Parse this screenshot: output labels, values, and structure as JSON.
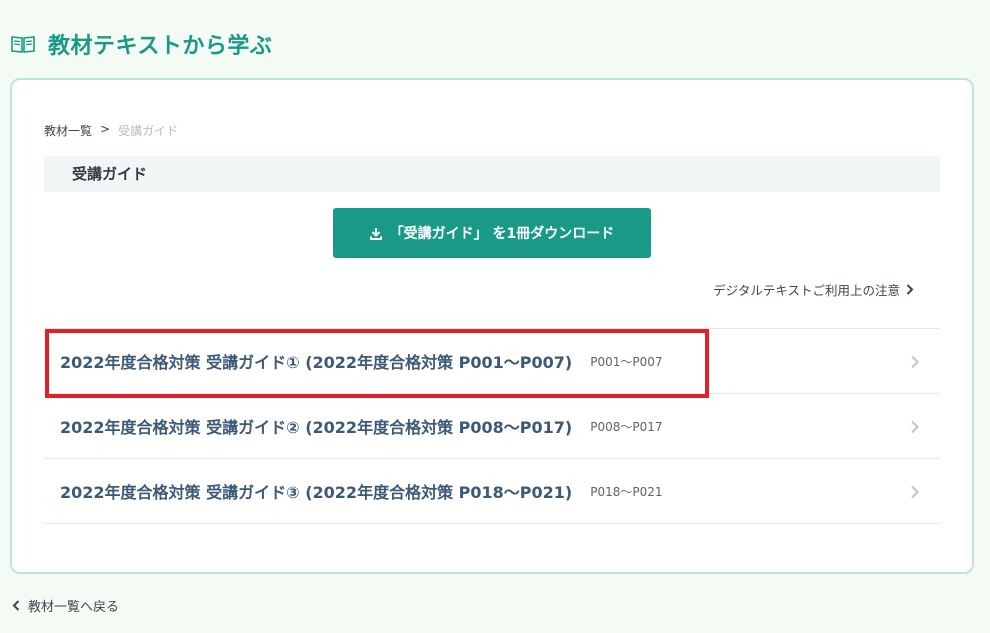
{
  "header": {
    "title": "教材テキストから学ぶ",
    "icon": "book-icon"
  },
  "breadcrumb": {
    "items": [
      "教材一覧",
      ">",
      "受講ガイド"
    ]
  },
  "section": {
    "title": "受講ガイド"
  },
  "download_button": {
    "label": "「受講ガイド」 を1冊ダウンロード",
    "icon": "download-icon"
  },
  "notice_link": {
    "label": "デジタルテキストご利用上の注意"
  },
  "items": [
    {
      "title": "2022年度合格対策 受講ガイド① (2022年度合格対策 P001〜P007)",
      "pages": "P001〜P007"
    },
    {
      "title": "2022年度合格対策 受講ガイド② (2022年度合格対策 P008〜P017)",
      "pages": "P008〜P017"
    },
    {
      "title": "2022年度合格対策 受講ガイド③ (2022年度合格対策 P018〜P021)",
      "pages": "P018〜P021"
    }
  ],
  "back_link": {
    "label": "教材一覧へ戻る"
  },
  "colors": {
    "accent": "#1a9a86",
    "highlight": "#e0202a",
    "background": "#f4fbf4"
  }
}
